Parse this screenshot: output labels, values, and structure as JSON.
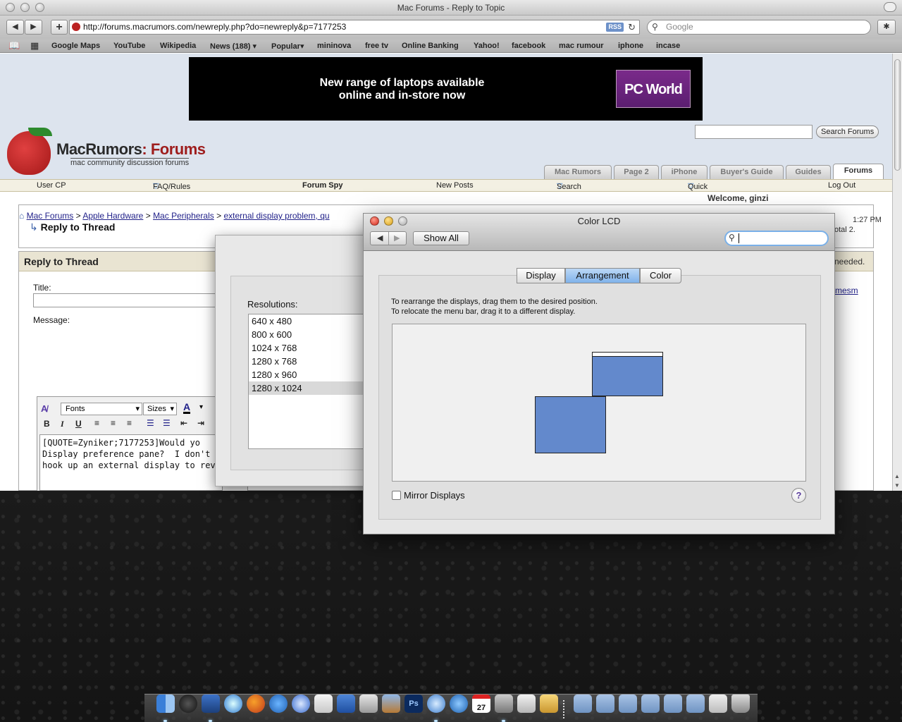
{
  "safari": {
    "window_title": "Mac Forums - Reply to Topic",
    "url": "http://forums.macrumors.com/newreply.php?do=newreply&p=7177253",
    "rss": "RSS",
    "search_placeholder": "Google",
    "bookmarks": [
      "Google Maps",
      "YouTube",
      "Wikipedia",
      "News (188)",
      "Popular",
      "mininova",
      "free tv",
      "Online Banking",
      "Yahoo!",
      "facebook",
      "mac rumour",
      "iphone",
      "incase"
    ]
  },
  "forum": {
    "ad_line1": "New range of laptops available",
    "ad_line2": "online and in-store now",
    "ad_brand": "PC World",
    "search_button": "Search Forums",
    "logo_brand": "MacRumors",
    "logo_suffix": ": Forums",
    "logo_tagline": "mac community discussion forums",
    "tabs": [
      "Mac Rumors",
      "Page 2",
      "iPhone",
      "Buyer's Guide",
      "Guides",
      "Forums"
    ],
    "nav": [
      "User CP",
      "FAQ/Rules",
      "Forum Spy",
      "New Posts",
      "Search",
      "Quick Links",
      "Log Out"
    ],
    "breadcrumb": [
      "Mac Forums",
      "Apple Hardware",
      "Mac Peripherals",
      "external display problem, qu"
    ],
    "breadcrumb_sep": ">",
    "page_heading": "Reply to Thread",
    "reply_box_title": "Reply to Thread",
    "title_label": "Title:",
    "message_label": "Message:",
    "fonts_label": "Fonts",
    "sizes_label": "Sizes",
    "editor_buttons": [
      "B",
      "I",
      "U"
    ],
    "message_text": "[QUOTE=Zyniker;7177253]Would yo\nDisplay preference pane?  I don't wa\nhook up an external display to revea",
    "right_fragments": {
      "welcome": "Welcome, ginzi",
      "time": "1:27 PM",
      "total": "otal 2.",
      "needed": "needed.",
      "user": "mesm"
    }
  },
  "resolutions_window": {
    "label": "Resolutions:",
    "items": [
      "640 x 480",
      "800 x 600",
      "1024 x 768",
      "1280 x 768",
      "1280 x 960",
      "1280 x 1024"
    ],
    "selected": "1280 x 1024"
  },
  "color_lcd": {
    "title": "Color LCD",
    "show_all": "Show All",
    "tabs": [
      "Display",
      "Arrangement",
      "Color"
    ],
    "active_tab": "Arrangement",
    "instruction1": "To rearrange the displays, drag them to the desired position.",
    "instruction2": "To relocate the menu bar, drag it to a different display.",
    "mirror_label": "Mirror Displays",
    "help": "?"
  },
  "dock": {
    "items": [
      "finder-icon",
      "dashboard-icon",
      "xcode-icon",
      "safari-icon",
      "firefox-icon",
      "ichat-icon",
      "mail-icon",
      "script-icon",
      "word-icon",
      "preview-icon",
      "iphoto-icon",
      "photoshop-icon",
      "itunes-icon",
      "quicktime-icon",
      "ical-icon",
      "activity-icon",
      "textedit-icon",
      "stickies-icon",
      "folder-icon",
      "applications-icon",
      "music-icon",
      "documents-icon",
      "downloads-icon",
      "network-icon",
      "screen-icon",
      "trash-icon"
    ],
    "ical_date": "27"
  }
}
